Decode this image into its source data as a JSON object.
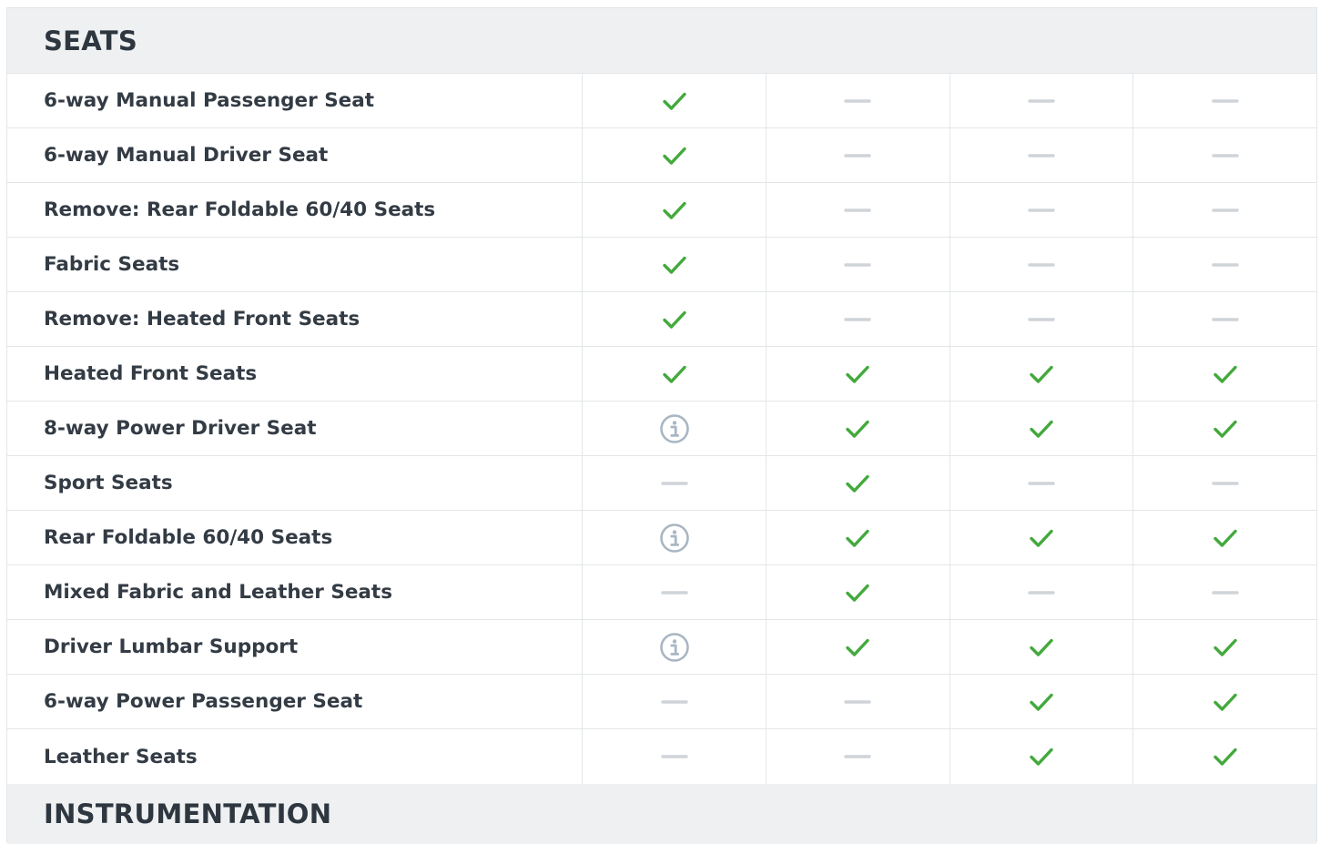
{
  "sections": {
    "seats_title": "SEATS",
    "instrumentation_title": "INSTRUMENTATION"
  },
  "rows": [
    {
      "label": "6-way Manual Passenger Seat",
      "values": [
        "check",
        "dash",
        "dash",
        "dash"
      ]
    },
    {
      "label": "6-way Manual Driver Seat",
      "values": [
        "check",
        "dash",
        "dash",
        "dash"
      ]
    },
    {
      "label": "Remove: Rear Foldable 60/40 Seats",
      "values": [
        "check",
        "dash",
        "dash",
        "dash"
      ]
    },
    {
      "label": "Fabric Seats",
      "values": [
        "check",
        "dash",
        "dash",
        "dash"
      ]
    },
    {
      "label": "Remove: Heated Front Seats",
      "values": [
        "check",
        "dash",
        "dash",
        "dash"
      ]
    },
    {
      "label": "Heated Front Seats",
      "values": [
        "check",
        "check",
        "check",
        "check"
      ]
    },
    {
      "label": "8-way Power Driver Seat",
      "values": [
        "info",
        "check",
        "check",
        "check"
      ]
    },
    {
      "label": "Sport Seats",
      "values": [
        "dash",
        "check",
        "dash",
        "dash"
      ]
    },
    {
      "label": "Rear Foldable 60/40 Seats",
      "values": [
        "info",
        "check",
        "check",
        "check"
      ]
    },
    {
      "label": "Mixed Fabric and Leather Seats",
      "values": [
        "dash",
        "check",
        "dash",
        "dash"
      ]
    },
    {
      "label": "Driver Lumbar Support",
      "values": [
        "info",
        "check",
        "check",
        "check"
      ]
    },
    {
      "label": "6-way Power Passenger Seat",
      "values": [
        "dash",
        "dash",
        "check",
        "check"
      ]
    },
    {
      "label": "Leather Seats",
      "values": [
        "dash",
        "dash",
        "check",
        "check"
      ]
    }
  ],
  "icons": {
    "check": "check-icon",
    "dash": "dash-icon",
    "info": "info-icon"
  },
  "colors": {
    "check": "#43a93c",
    "dash": "#cfd4d8",
    "info": "#a9b6c3"
  }
}
